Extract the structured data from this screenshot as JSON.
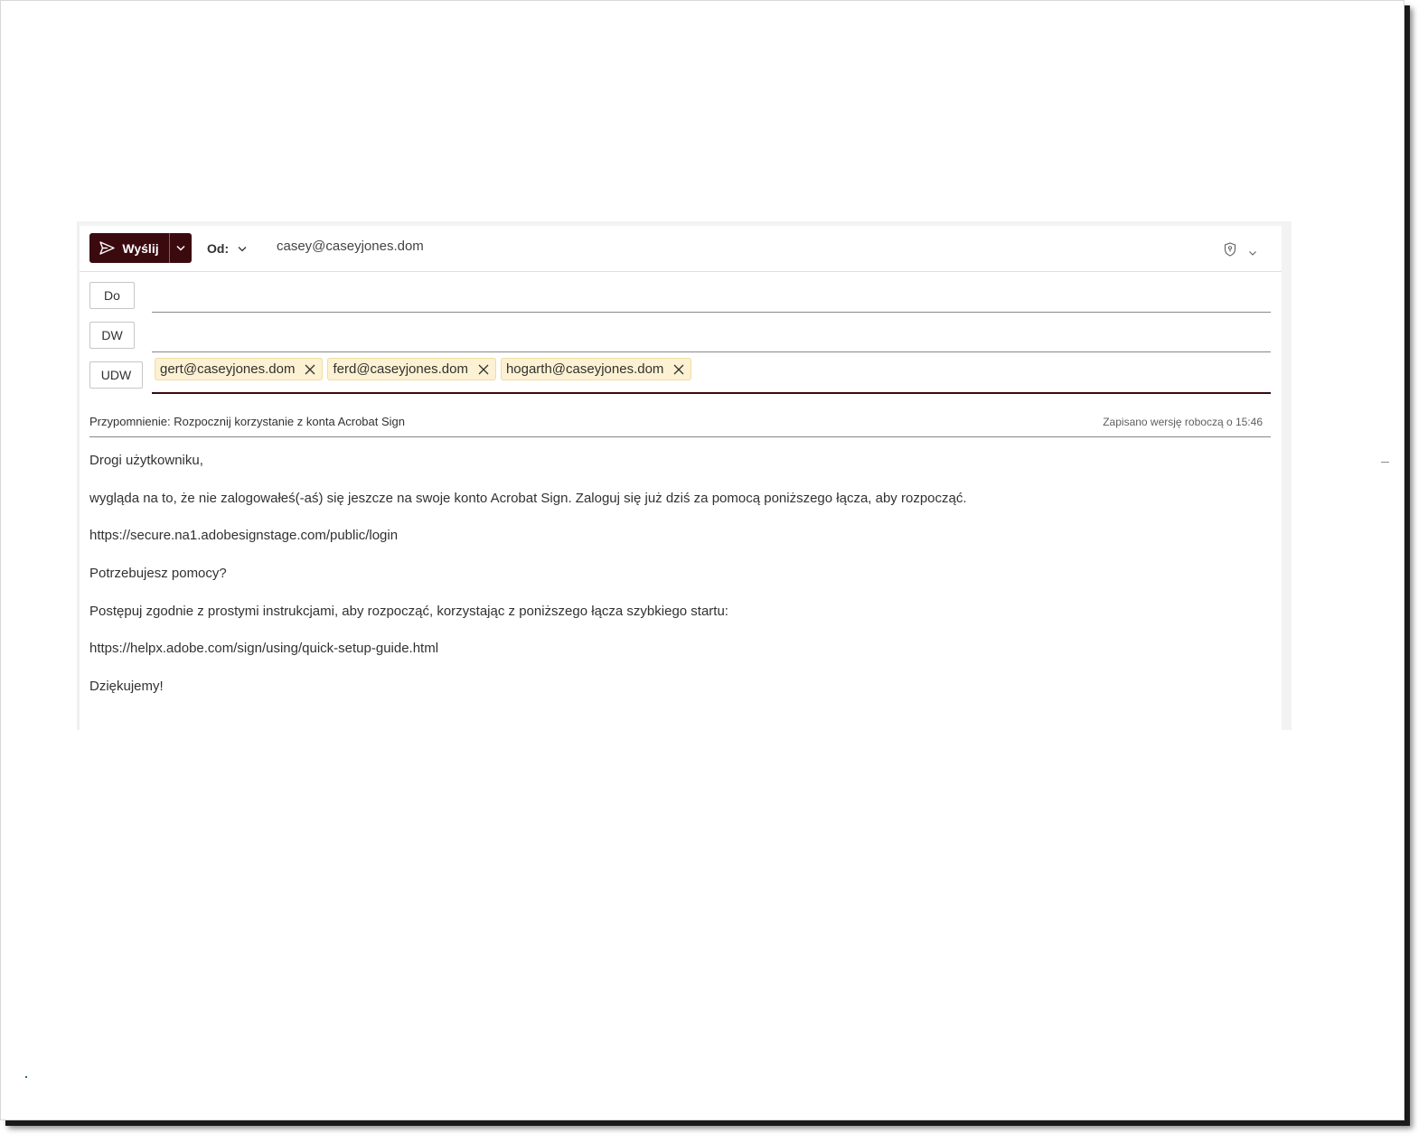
{
  "toolbar": {
    "send_label": "Wyślij",
    "from_label": "Od:",
    "from_value": "casey@caseyjones.dom"
  },
  "recipients": {
    "to_label": "Do",
    "cc_label": "DW",
    "bcc_label": "UDW",
    "bcc_chips": [
      "gert@caseyjones.dom",
      "ferd@caseyjones.dom",
      "hogarth@caseyjones.dom"
    ]
  },
  "subject": {
    "text": "Przypomnienie: Rozpocznij korzystanie z konta Acrobat Sign",
    "draft_status": "Zapisano wersję roboczą o 15:46"
  },
  "body": {
    "lines": [
      "Drogi użytkowniku,",
      "wygląda na to, że nie zalogowałeś(-aś) się jeszcze na swoje konto Acrobat Sign. Zaloguj się już dziś za pomocą poniższego łącza, aby rozpocząć.",
      "https://secure.na1.adobesignstage.com/public/login",
      "Potrzebujesz pomocy?",
      "Postępuj zgodnie z prostymi instrukcjami, aby rozpocząć, korzystając z poniższego łącza szybkiego startu:",
      "https://helpx.adobe.com/sign/using/quick-setup-guide.html",
      "Dziękujemy!"
    ]
  },
  "colors": {
    "send_button": "#3b0a0f",
    "chip_background": "#fcf1d2"
  }
}
